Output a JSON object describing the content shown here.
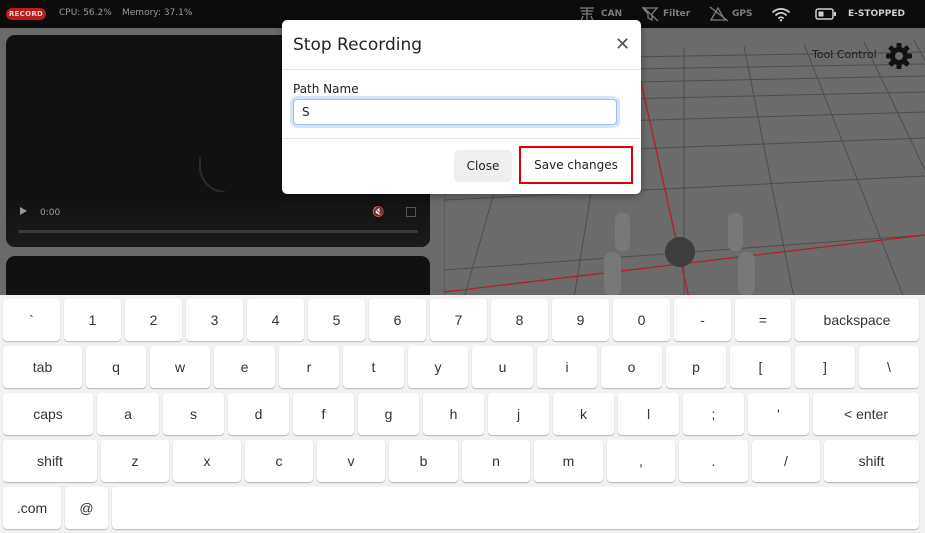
{
  "topbar": {
    "record_badge": "RECORD",
    "cpu": "CPU: 56.2%",
    "memory": "Memory: 37.1%",
    "status": [
      {
        "icon": "can-icon",
        "label": "CAN"
      },
      {
        "icon": "filter-icon",
        "label": "Filter"
      },
      {
        "icon": "gps-icon",
        "label": "GPS"
      },
      {
        "icon": "wifi-icon",
        "label": ""
      },
      {
        "icon": "battery-icon",
        "label": "E-STOPPED"
      }
    ]
  },
  "video": {
    "time": "0:00"
  },
  "view3d": {
    "tool_label": "Tool Control"
  },
  "dialog": {
    "title": "Stop Recording",
    "field_label": "Path Name",
    "field_value": "S",
    "close_label": "Close",
    "save_label": "Save changes"
  },
  "keyboard": {
    "rows": [
      [
        "`",
        "1",
        "2",
        "3",
        "4",
        "5",
        "6",
        "7",
        "8",
        "9",
        "0",
        "-",
        "=",
        "backspace"
      ],
      [
        "tab",
        "q",
        "w",
        "e",
        "r",
        "t",
        "y",
        "u",
        "i",
        "o",
        "p",
        "[",
        "]",
        "\\"
      ],
      [
        "caps",
        "a",
        "s",
        "d",
        "f",
        "g",
        "h",
        "j",
        "k",
        "l",
        ";",
        "'",
        "< enter"
      ],
      [
        "shift",
        "z",
        "x",
        "c",
        "v",
        "b",
        "n",
        "m",
        ",",
        ".",
        "/",
        "shift"
      ],
      [
        ".com",
        "@",
        ""
      ]
    ]
  },
  "colors": {
    "record": "#b81c1c",
    "highlight": "#e00000",
    "grid_axis": "#b02020"
  }
}
